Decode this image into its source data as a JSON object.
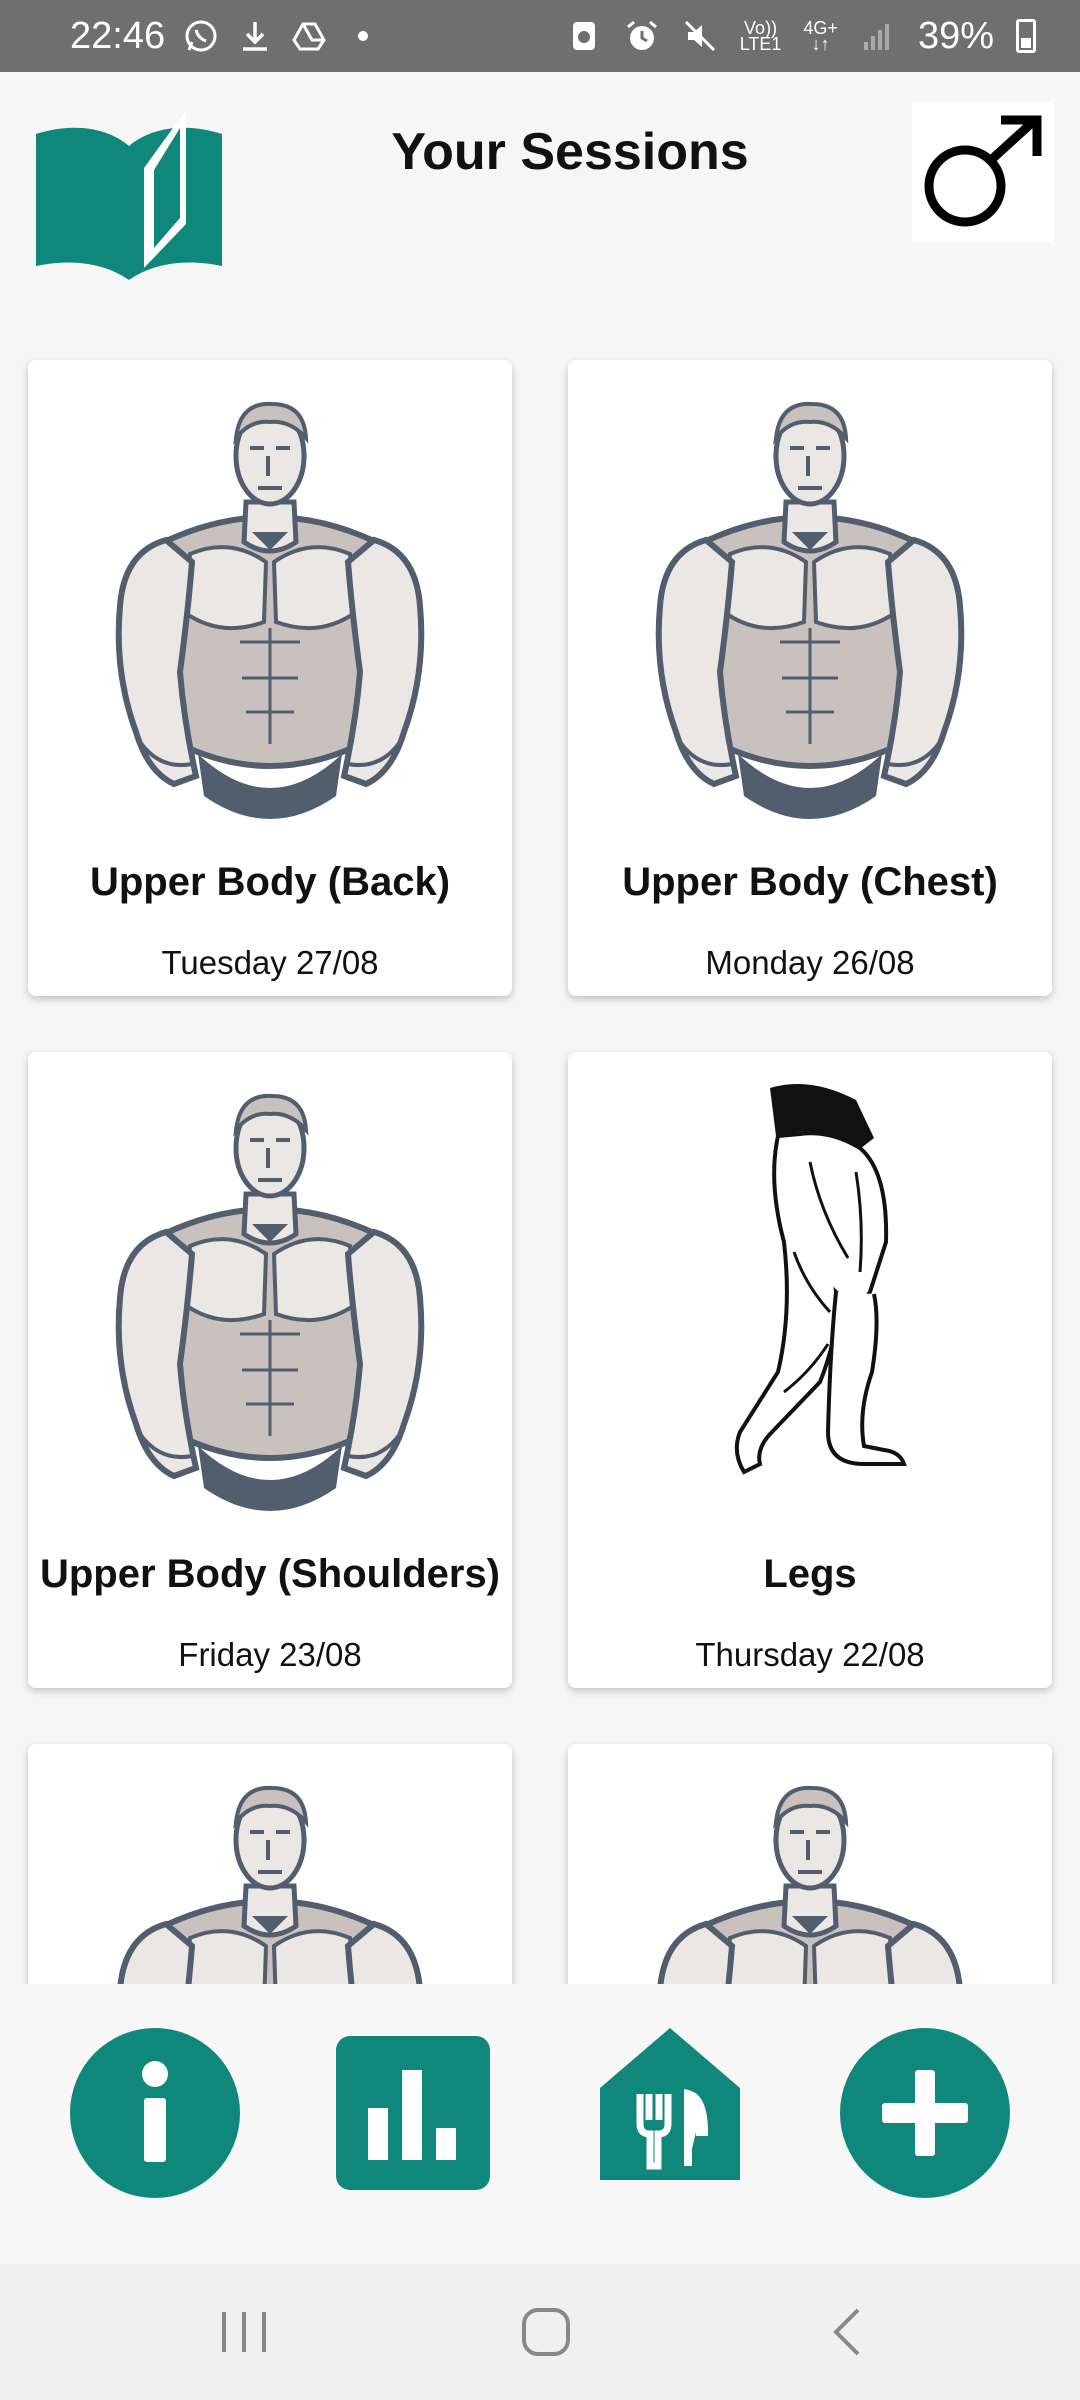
{
  "status_bar": {
    "time": "22:46",
    "left_icons": [
      "whatsapp-icon",
      "download-icon",
      "drive-icon",
      "dot-icon"
    ],
    "right_icons": [
      "screen-record-icon",
      "alarm-icon",
      "mute-icon",
      "volte-icon",
      "4g-icon",
      "signal-icon"
    ],
    "volte_top": "Vo))",
    "volte_bottom": "LTE1",
    "network": "4G+",
    "battery": "39%"
  },
  "header": {
    "title": "Your Sessions",
    "left_icon": "book-icon",
    "right_icon": "male-symbol-icon"
  },
  "sessions": [
    {
      "title": "Upper Body (Back)",
      "date": "Tuesday 27/08",
      "image": "upper-body-figure"
    },
    {
      "title": "Upper Body (Chest)",
      "date": "Monday 26/08",
      "image": "upper-body-figure"
    },
    {
      "title": "Upper Body (Shoulders)",
      "date": "Friday 23/08",
      "image": "upper-body-figure"
    },
    {
      "title": "Legs",
      "date": "Thursday 22/08",
      "image": "legs-figure"
    },
    {
      "title": "",
      "date": "",
      "image": "upper-body-figure"
    },
    {
      "title": "",
      "date": "",
      "image": "upper-body-figure"
    }
  ],
  "bottom_nav": {
    "buttons": [
      "info-icon",
      "stats-icon",
      "meal-icon",
      "add-icon"
    ]
  },
  "colors": {
    "accent": "#0f877a",
    "status_bar": "#6f6f6f",
    "figure_dark": "#525e6e",
    "figure_skin": "#c9c1bd"
  }
}
